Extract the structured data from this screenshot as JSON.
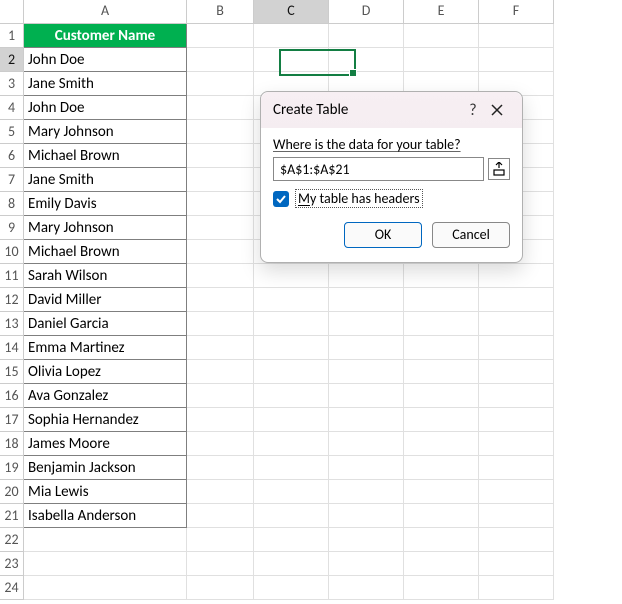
{
  "columns": [
    "A",
    "B",
    "C",
    "D",
    "E",
    "F"
  ],
  "header_label": "Customer Name",
  "rows": [
    "John Doe",
    "Jane Smith",
    "John Doe",
    "Mary Johnson",
    "Michael Brown",
    "Jane Smith",
    "Emily Davis",
    "Mary Johnson",
    "Michael Brown",
    "Sarah Wilson",
    "David Miller",
    "Daniel Garcia",
    "Emma Martinez",
    "Olivia Lopez",
    "Ava Gonzalez",
    "Sophia Hernandez",
    "James Moore",
    "Benjamin Jackson",
    "Mia Lewis",
    "Isabella Anderson"
  ],
  "row_numbers": [
    1,
    2,
    3,
    4,
    5,
    6,
    7,
    8,
    9,
    10,
    11,
    12,
    13,
    14,
    15,
    16,
    17,
    18,
    19,
    20,
    21,
    22,
    23,
    24
  ],
  "active_col": "C",
  "active_row": 2,
  "dialog": {
    "title": "Create Table",
    "help": "?",
    "prompt": "Where is the data for your table?",
    "range": "$A$1:$A$21",
    "checkbox_checked": true,
    "checkbox_label_pre": "M",
    "checkbox_label_rest": "y table has headers",
    "ok": "OK",
    "cancel": "Cancel"
  }
}
